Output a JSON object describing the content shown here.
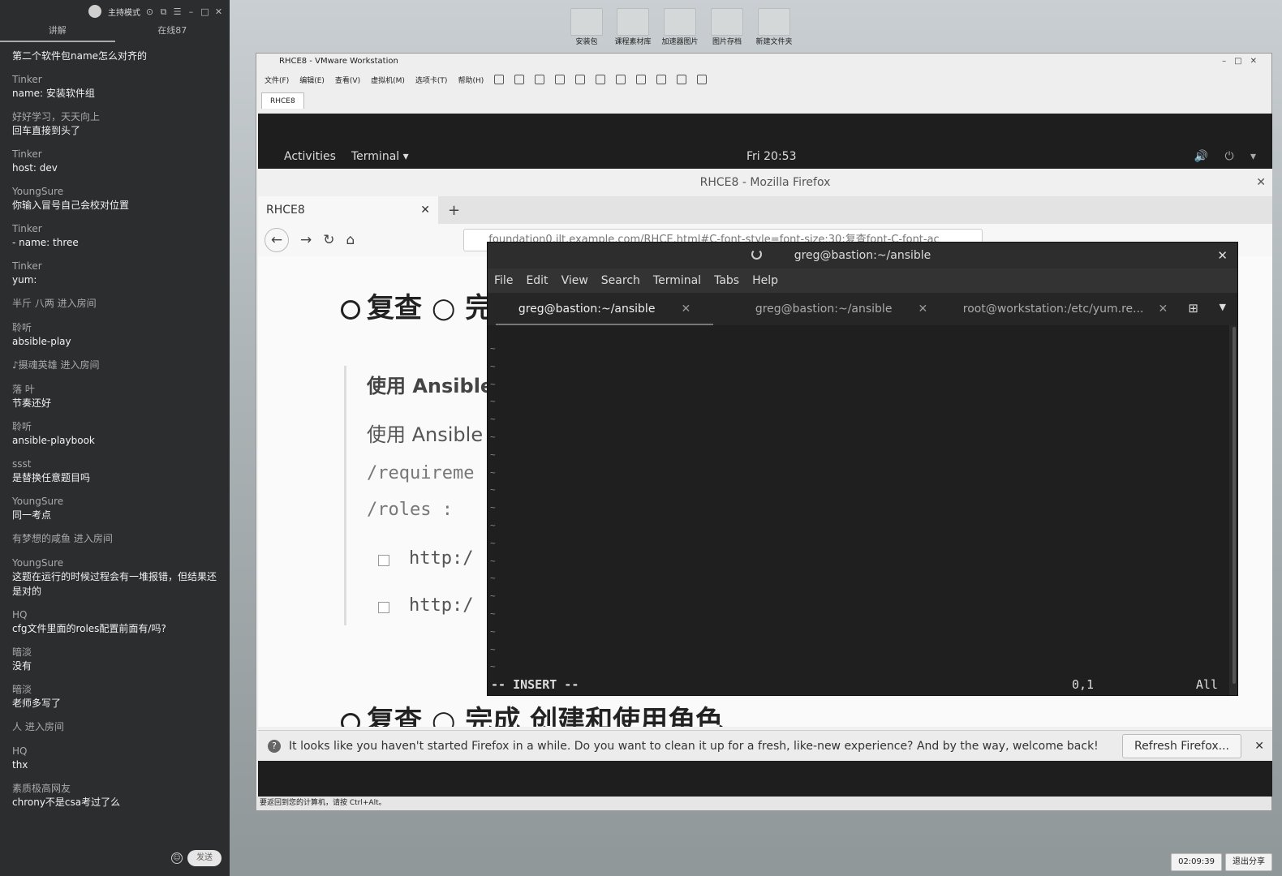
{
  "chat": {
    "header_title": "主持模式",
    "tabs": [
      "讲解",
      "在线87"
    ],
    "messages": [
      {
        "type": "msg",
        "name": "",
        "text": "第二个软件包name怎么对齐的"
      },
      {
        "type": "msg",
        "name": "Tinker",
        "text": "name: 安装软件组"
      },
      {
        "type": "msg",
        "name": "好好学习，天天向上",
        "text": "回车直接到头了"
      },
      {
        "type": "msg",
        "name": "Tinker",
        "text": "host: dev"
      },
      {
        "type": "msg",
        "name": "YoungSure",
        "text": "你输入冒号自己会校对位置"
      },
      {
        "type": "msg",
        "name": "Tinker",
        "text": "- name: three"
      },
      {
        "type": "msg",
        "name": "Tinker",
        "text": "yum:"
      },
      {
        "type": "sys",
        "text": "半斤  八两 进入房间"
      },
      {
        "type": "msg",
        "name": "聆听",
        "text": "absible-play"
      },
      {
        "type": "sys",
        "text": "♪摄魂英雄 进入房间"
      },
      {
        "type": "msg",
        "name": "落 叶",
        "text": "节奏还好"
      },
      {
        "type": "msg",
        "name": "聆听",
        "text": "ansible-playbook"
      },
      {
        "type": "msg",
        "name": "ssst",
        "text": "是替换任意题目吗"
      },
      {
        "type": "msg",
        "name": "YoungSure",
        "text": "同一考点"
      },
      {
        "type": "sys",
        "text": "有梦想的咸鱼 进入房间"
      },
      {
        "type": "msg",
        "name": "YoungSure",
        "text": "这题在运行的时候过程会有一堆报错，但结果还是对的"
      },
      {
        "type": "msg",
        "name": "HQ",
        "text": "cfg文件里面的roles配置前面有/吗?"
      },
      {
        "type": "msg",
        "name": "暗淡",
        "text": "没有"
      },
      {
        "type": "msg",
        "name": "暗淡",
        "text": "老师多写了"
      },
      {
        "type": "sys",
        "text": "人 进入房间"
      },
      {
        "type": "msg",
        "name": "HQ",
        "text": "thx"
      },
      {
        "type": "msg",
        "name": "素质极高网友",
        "text": "chrony不是csa考过了么"
      }
    ],
    "send_label": "发送"
  },
  "desktop_icons": [
    "安装包",
    "课程素材库",
    "加速器图片",
    "图片存档",
    "新建文件夹"
  ],
  "vmware": {
    "title": "RHCE8 - VMware Workstation",
    "menu": [
      "文件(F)",
      "编辑(E)",
      "查看(V)",
      "虚拟机(M)",
      "选项卡(T)",
      "帮助(H)"
    ],
    "tab": "RHCE8",
    "status": "要返回到您的计算机，请按 Ctrl+Alt。"
  },
  "gnome": {
    "activities": "Activities",
    "app": "Terminal ▾",
    "clock": "Fri 20:53",
    "tray": "🔊 ⏻ ▾"
  },
  "firefox": {
    "title": "RHCE8 - Mozilla Firefox",
    "tab": "RHCE8",
    "url": "foundation0.ilt.example.com/RHCE.html#C-font-style=font-size:30;复查font-C-font-ac",
    "heading_top": "复查 ○ 完",
    "heading_bottom": "复查 ○ 完成 创建和使用角色",
    "para1": "使用 Ansible",
    "para2": "使用 Ansible",
    "path1": "/requireme",
    "path2": "/roles :",
    "link1": "http:/",
    "link2": "http:/",
    "notice": "It looks like you haven't started Firefox in a while. Do you want to clean it up for a fresh, like-new experience? And by the way, welcome back!",
    "refresh_label": "Refresh Firefox..."
  },
  "terminal": {
    "title": "greg@bastion:~/ansible",
    "menu": [
      "File",
      "Edit",
      "View",
      "Search",
      "Terminal",
      "Tabs",
      "Help"
    ],
    "tabs": [
      "greg@bastion:~/ansible",
      "greg@bastion:~/ansible",
      "root@workstation:/etc/yum.re..."
    ],
    "mode": "-- INSERT --",
    "position": "0,1",
    "scroll": "All"
  },
  "taskbar": {
    "timer": "02:09:39",
    "exit_share": "退出分享"
  }
}
